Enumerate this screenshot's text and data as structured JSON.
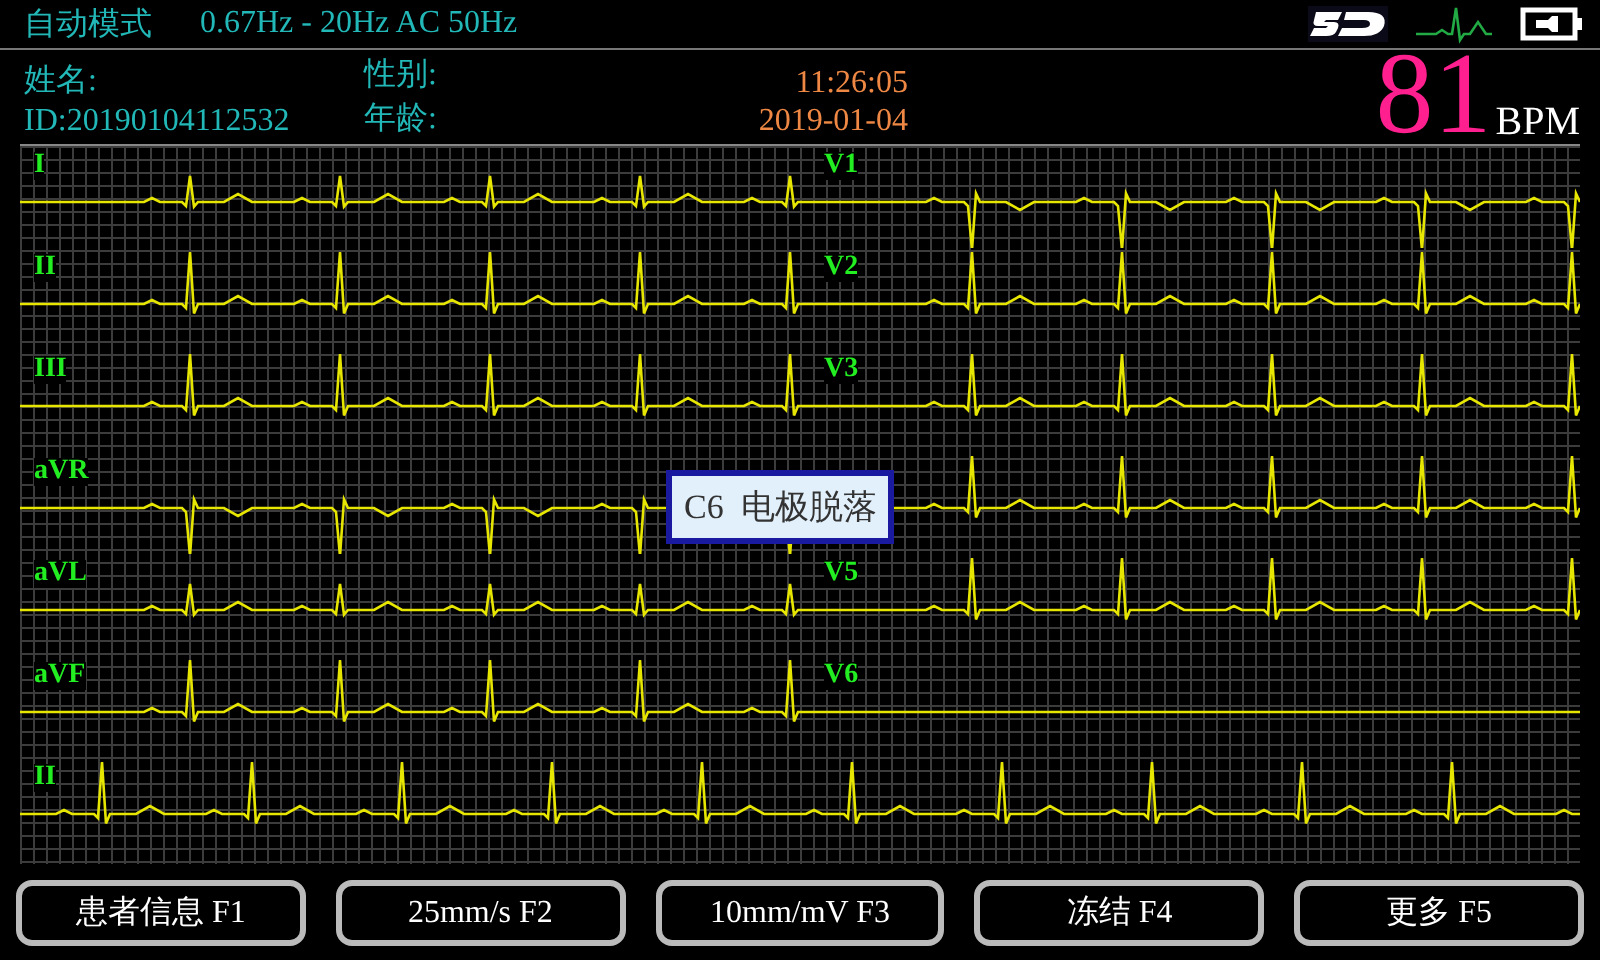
{
  "header": {
    "mode": "自动模式",
    "filter": "0.67Hz - 20Hz AC 50Hz"
  },
  "patient": {
    "name_label": "姓名:",
    "sex_label": "性别:",
    "id": "ID:20190104112532",
    "age_label": "年龄:",
    "time": "11:26:05",
    "date": "2019-01-04"
  },
  "heart_rate": {
    "value": "81",
    "unit": "BPM"
  },
  "leads_left": [
    {
      "label": "I",
      "kind": "small"
    },
    {
      "label": "II",
      "kind": "upright"
    },
    {
      "label": "III",
      "kind": "upright"
    },
    {
      "label": "aVR",
      "kind": "inverted"
    },
    {
      "label": "aVL",
      "kind": "small"
    },
    {
      "label": "aVF",
      "kind": "upright"
    }
  ],
  "leads_right": [
    {
      "label": "V1",
      "kind": "inverted"
    },
    {
      "label": "V2",
      "kind": "upright"
    },
    {
      "label": "V3",
      "kind": "upright"
    },
    {
      "kind": "upright"
    },
    {
      "label": "V5",
      "kind": "upright"
    },
    {
      "label": "V6",
      "kind": "flat"
    }
  ],
  "rhythm": {
    "label": "II",
    "kind": "upright"
  },
  "alert": {
    "text": "C6  电极脱落"
  },
  "buttons": [
    "患者信息 F1",
    "25mm/s F2",
    "10mm/mV F3",
    "冻结 F4",
    "更多 F5"
  ]
}
